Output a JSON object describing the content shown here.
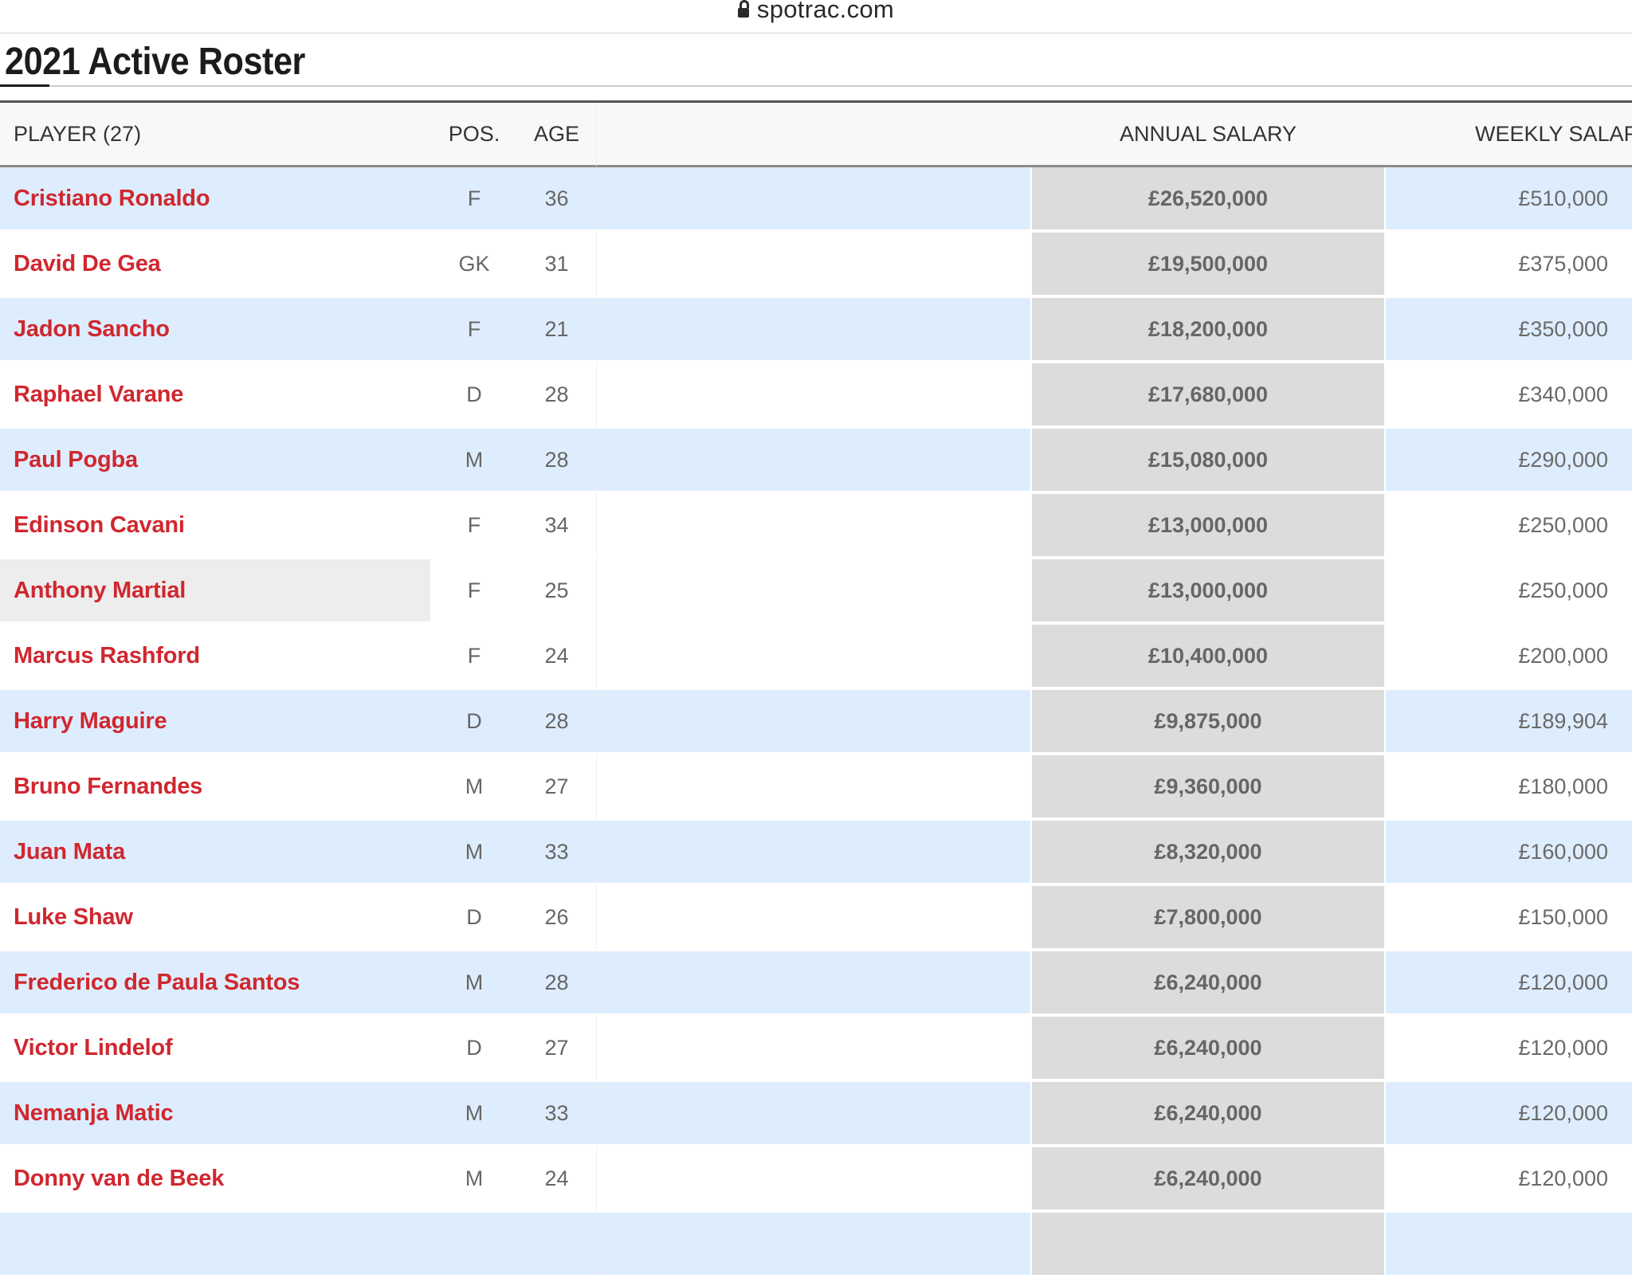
{
  "browser": {
    "url": "spotrac.com"
  },
  "page": {
    "title": "2021 Active Roster"
  },
  "table": {
    "headers": {
      "player": "PLAYER (27)",
      "pos": "POS.",
      "age": "AGE",
      "annual": "ANNUAL SALARY",
      "weekly": "WEEKLY SALARY"
    },
    "rows": [
      {
        "player": "Cristiano Ronaldo",
        "pos": "F",
        "age": "36",
        "annual": "£26,520,000",
        "weekly": "£510,000"
      },
      {
        "player": "David De Gea",
        "pos": "GK",
        "age": "31",
        "annual": "£19,500,000",
        "weekly": "£375,000"
      },
      {
        "player": "Jadon Sancho",
        "pos": "F",
        "age": "21",
        "annual": "£18,200,000",
        "weekly": "£350,000"
      },
      {
        "player": "Raphael Varane",
        "pos": "D",
        "age": "28",
        "annual": "£17,680,000",
        "weekly": "£340,000"
      },
      {
        "player": "Paul Pogba",
        "pos": "M",
        "age": "28",
        "annual": "£15,080,000",
        "weekly": "£290,000"
      },
      {
        "player": "Edinson Cavani",
        "pos": "F",
        "age": "34",
        "annual": "£13,000,000",
        "weekly": "£250,000"
      },
      {
        "player": "Anthony Martial",
        "pos": "F",
        "age": "25",
        "annual": "£13,000,000",
        "weekly": "£250,000"
      },
      {
        "player": "Marcus Rashford",
        "pos": "F",
        "age": "24",
        "annual": "£10,400,000",
        "weekly": "£200,000"
      },
      {
        "player": "Harry Maguire",
        "pos": "D",
        "age": "28",
        "annual": "£9,875,000",
        "weekly": "£189,904"
      },
      {
        "player": "Bruno Fernandes",
        "pos": "M",
        "age": "27",
        "annual": "£9,360,000",
        "weekly": "£180,000"
      },
      {
        "player": "Juan Mata",
        "pos": "M",
        "age": "33",
        "annual": "£8,320,000",
        "weekly": "£160,000"
      },
      {
        "player": "Luke Shaw",
        "pos": "D",
        "age": "26",
        "annual": "£7,800,000",
        "weekly": "£150,000"
      },
      {
        "player": "Frederico de Paula Santos",
        "pos": "M",
        "age": "28",
        "annual": "£6,240,000",
        "weekly": "£120,000"
      },
      {
        "player": "Victor Lindelof",
        "pos": "D",
        "age": "27",
        "annual": "£6,240,000",
        "weekly": "£120,000"
      },
      {
        "player": "Nemanja Matic",
        "pos": "M",
        "age": "33",
        "annual": "£6,240,000",
        "weekly": "£120,000"
      },
      {
        "player": "Donny van de Beek",
        "pos": "M",
        "age": "24",
        "annual": "£6,240,000",
        "weekly": "£120,000"
      }
    ]
  },
  "colors": {
    "player_link": "#d0272f",
    "row_alt": "#deedfd",
    "row_hover": "#ededed",
    "annual_column": "#dcdcdc"
  }
}
